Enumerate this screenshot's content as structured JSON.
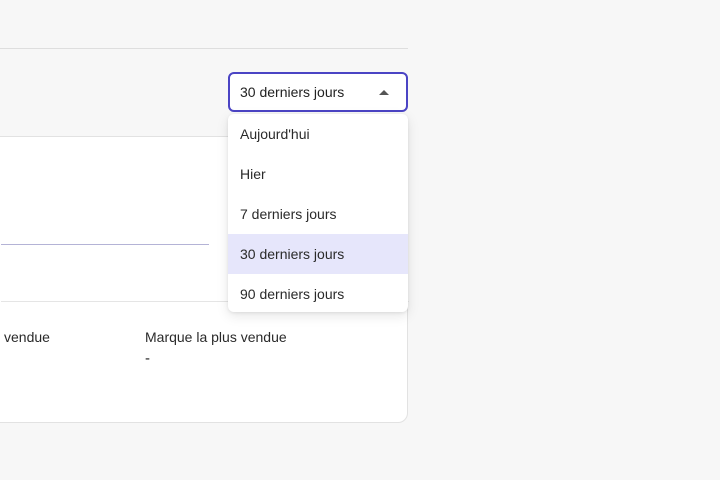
{
  "period_select": {
    "value": "30 derniers jours",
    "options": [
      {
        "label": "Aujourd'hui",
        "selected": false
      },
      {
        "label": "Hier",
        "selected": false
      },
      {
        "label": "7 derniers jours",
        "selected": false
      },
      {
        "label": "30 derniers jours",
        "selected": true
      },
      {
        "label": "90 derniers jours",
        "selected": false
      }
    ]
  },
  "stats": {
    "left_label_fragment": "vendue",
    "top_brand_label": "Marque la plus vendue",
    "top_brand_value": "-"
  },
  "colors": {
    "accent": "#4b44c4",
    "selected_bg": "#e6e6fb",
    "page_bg": "#f7f7f7"
  },
  "icons": {
    "select_caret": "caret-up-icon"
  }
}
